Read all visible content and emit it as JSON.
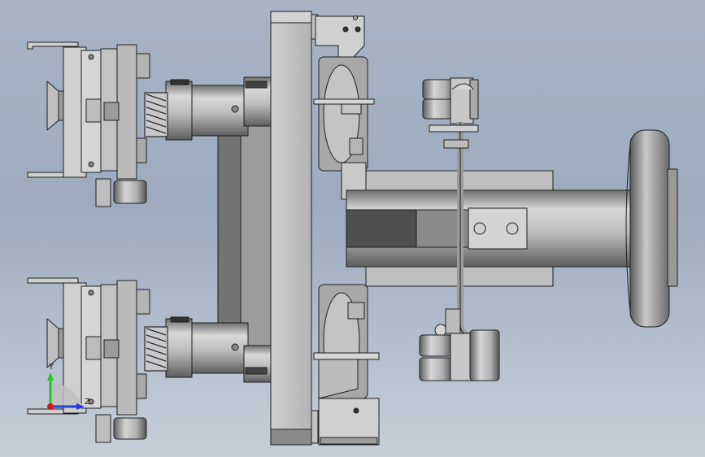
{
  "viewport": {
    "name": "cad-3d-viewport"
  },
  "model": {
    "name": "pneumatic-gripper-assembly",
    "colors": {
      "steel_light": "#d9d9d9",
      "steel_mid": "#b8b8b8",
      "steel_dark": "#7a7a7a",
      "steel_shadow": "#5a5a5a",
      "plate_dark": "#6e6e6e",
      "edge": "#1e1e1e"
    }
  },
  "triad": {
    "y_label": "Y",
    "z_label": "Z",
    "colors": {
      "y_axis": "#22c522",
      "z_axis": "#1f3fe0",
      "x_axis": "#d01818"
    }
  }
}
